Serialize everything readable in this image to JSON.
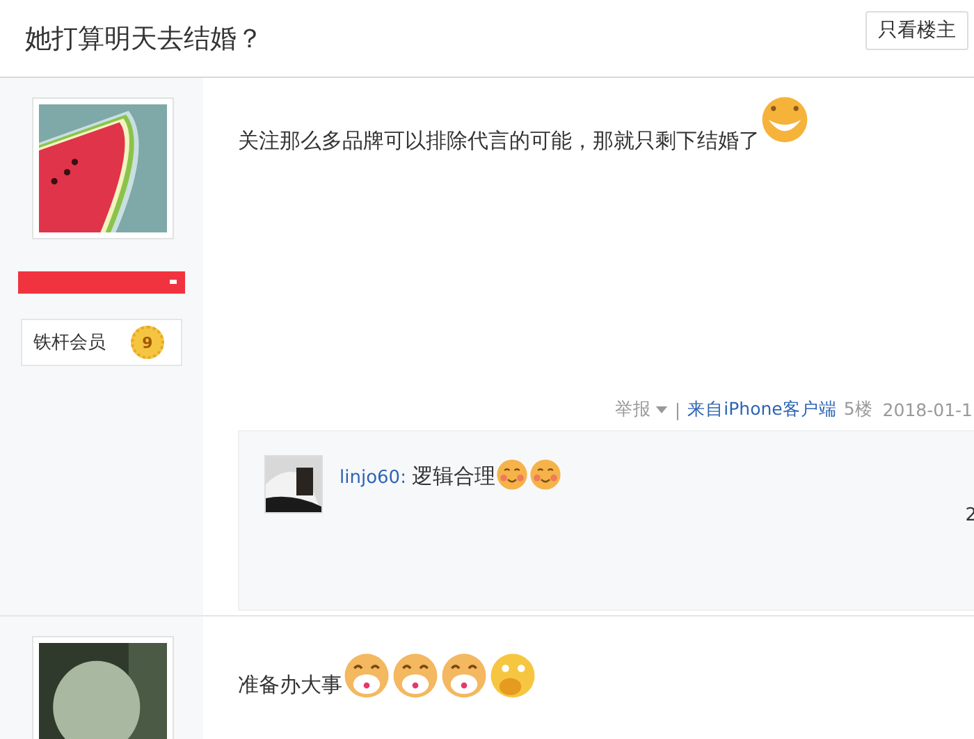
{
  "thread": {
    "title": "她打算明天去结婚？",
    "author_only_button": "只看楼主"
  },
  "posts": [
    {
      "avatar": {
        "kind": "picture"
      },
      "member": {
        "label": "铁杆会员",
        "level": "9"
      },
      "text": "关注那么多品牌可以排除代言的可能，那就只剩下结婚了",
      "emoticons": [
        {
          "kind": "smile"
        }
      ],
      "meta": {
        "report": "举报",
        "separator": "|",
        "source": "来自iPhone客户端",
        "floor": "5楼",
        "date": "2018-01-1"
      },
      "replies": [
        {
          "user": "linjo60:",
          "text": "逻辑合理",
          "emoticons": [
            {
              "kind": "blush"
            },
            {
              "kind": "blush"
            }
          ],
          "time": "2"
        }
      ]
    },
    {
      "avatar": {
        "kind": "picture"
      },
      "text": "准备办大事",
      "emoticons": [
        {
          "kind": "grin"
        },
        {
          "kind": "grin"
        },
        {
          "kind": "grin"
        },
        {
          "kind": "cover-mouth"
        }
      ]
    }
  ]
}
